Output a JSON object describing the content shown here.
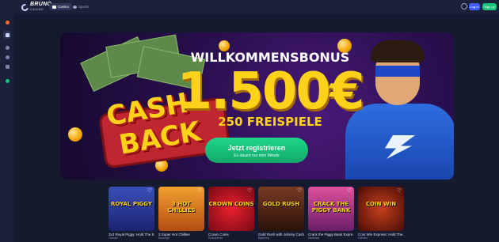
{
  "header": {
    "logo": {
      "name": "BRUNO",
      "tagline": "CASINO"
    },
    "tabs": [
      {
        "label": "Casino",
        "icon": "casino-icon",
        "active": true
      },
      {
        "label": "Sports",
        "icon": "sports-icon",
        "active": false
      }
    ],
    "login_label": "Log in",
    "signup_label": "Sign up"
  },
  "sidebar": {
    "items": [
      {
        "icon": "fire-icon",
        "color": "#ff6b35"
      },
      {
        "icon": "cards-icon",
        "color": "#cfd6ff",
        "active": true
      },
      {
        "icon": "trophy-icon",
        "color": "#7a84ad"
      },
      {
        "icon": "chip-icon",
        "color": "#7a84ad"
      },
      {
        "icon": "gamepad-icon",
        "color": "#7a84ad"
      },
      {
        "icon": "shield-icon",
        "color": "#19c37d"
      }
    ]
  },
  "banner": {
    "cashback_line1": "CASH",
    "cashback_line2": "BACK",
    "headline": "WILLKOMMENSBONUS",
    "amount": "1.500€",
    "spins": "250 FREISPIELE",
    "cta_label": "Jetzt registrieren",
    "cta_sub": "Es dauert nur eine Minute"
  },
  "games": [
    {
      "title": "3x3 Royal Piggy: Hold The S...",
      "provider": "Gamzix",
      "thumb_text": "ROYAL PIGGY",
      "bg": "#3a4fb8"
    },
    {
      "title": "3 Super Hot Chillies",
      "provider": "Booongo",
      "thumb_text": "3 HOT CHILLIES",
      "bg": "#d9731c"
    },
    {
      "title": "Crown Coins",
      "provider": "Endorphina",
      "thumb_text": "CROWN COINS",
      "bg": "#c0162a"
    },
    {
      "title": "Gold Rush with Johnny Cash",
      "provider": "Bgaming",
      "thumb_text": "GOLD RUSH",
      "bg": "#5b2a1c"
    },
    {
      "title": "Crack the Piggy Bank Expre...",
      "provider": "Hacksaw",
      "thumb_text": "CRACK THE PIGGY BANK",
      "bg": "#c0306d"
    },
    {
      "title": "Coin Win Express: Hold The...",
      "provider": "Gamzix",
      "thumb_text": "COIN WIN",
      "bg": "#7a1c12"
    }
  ]
}
